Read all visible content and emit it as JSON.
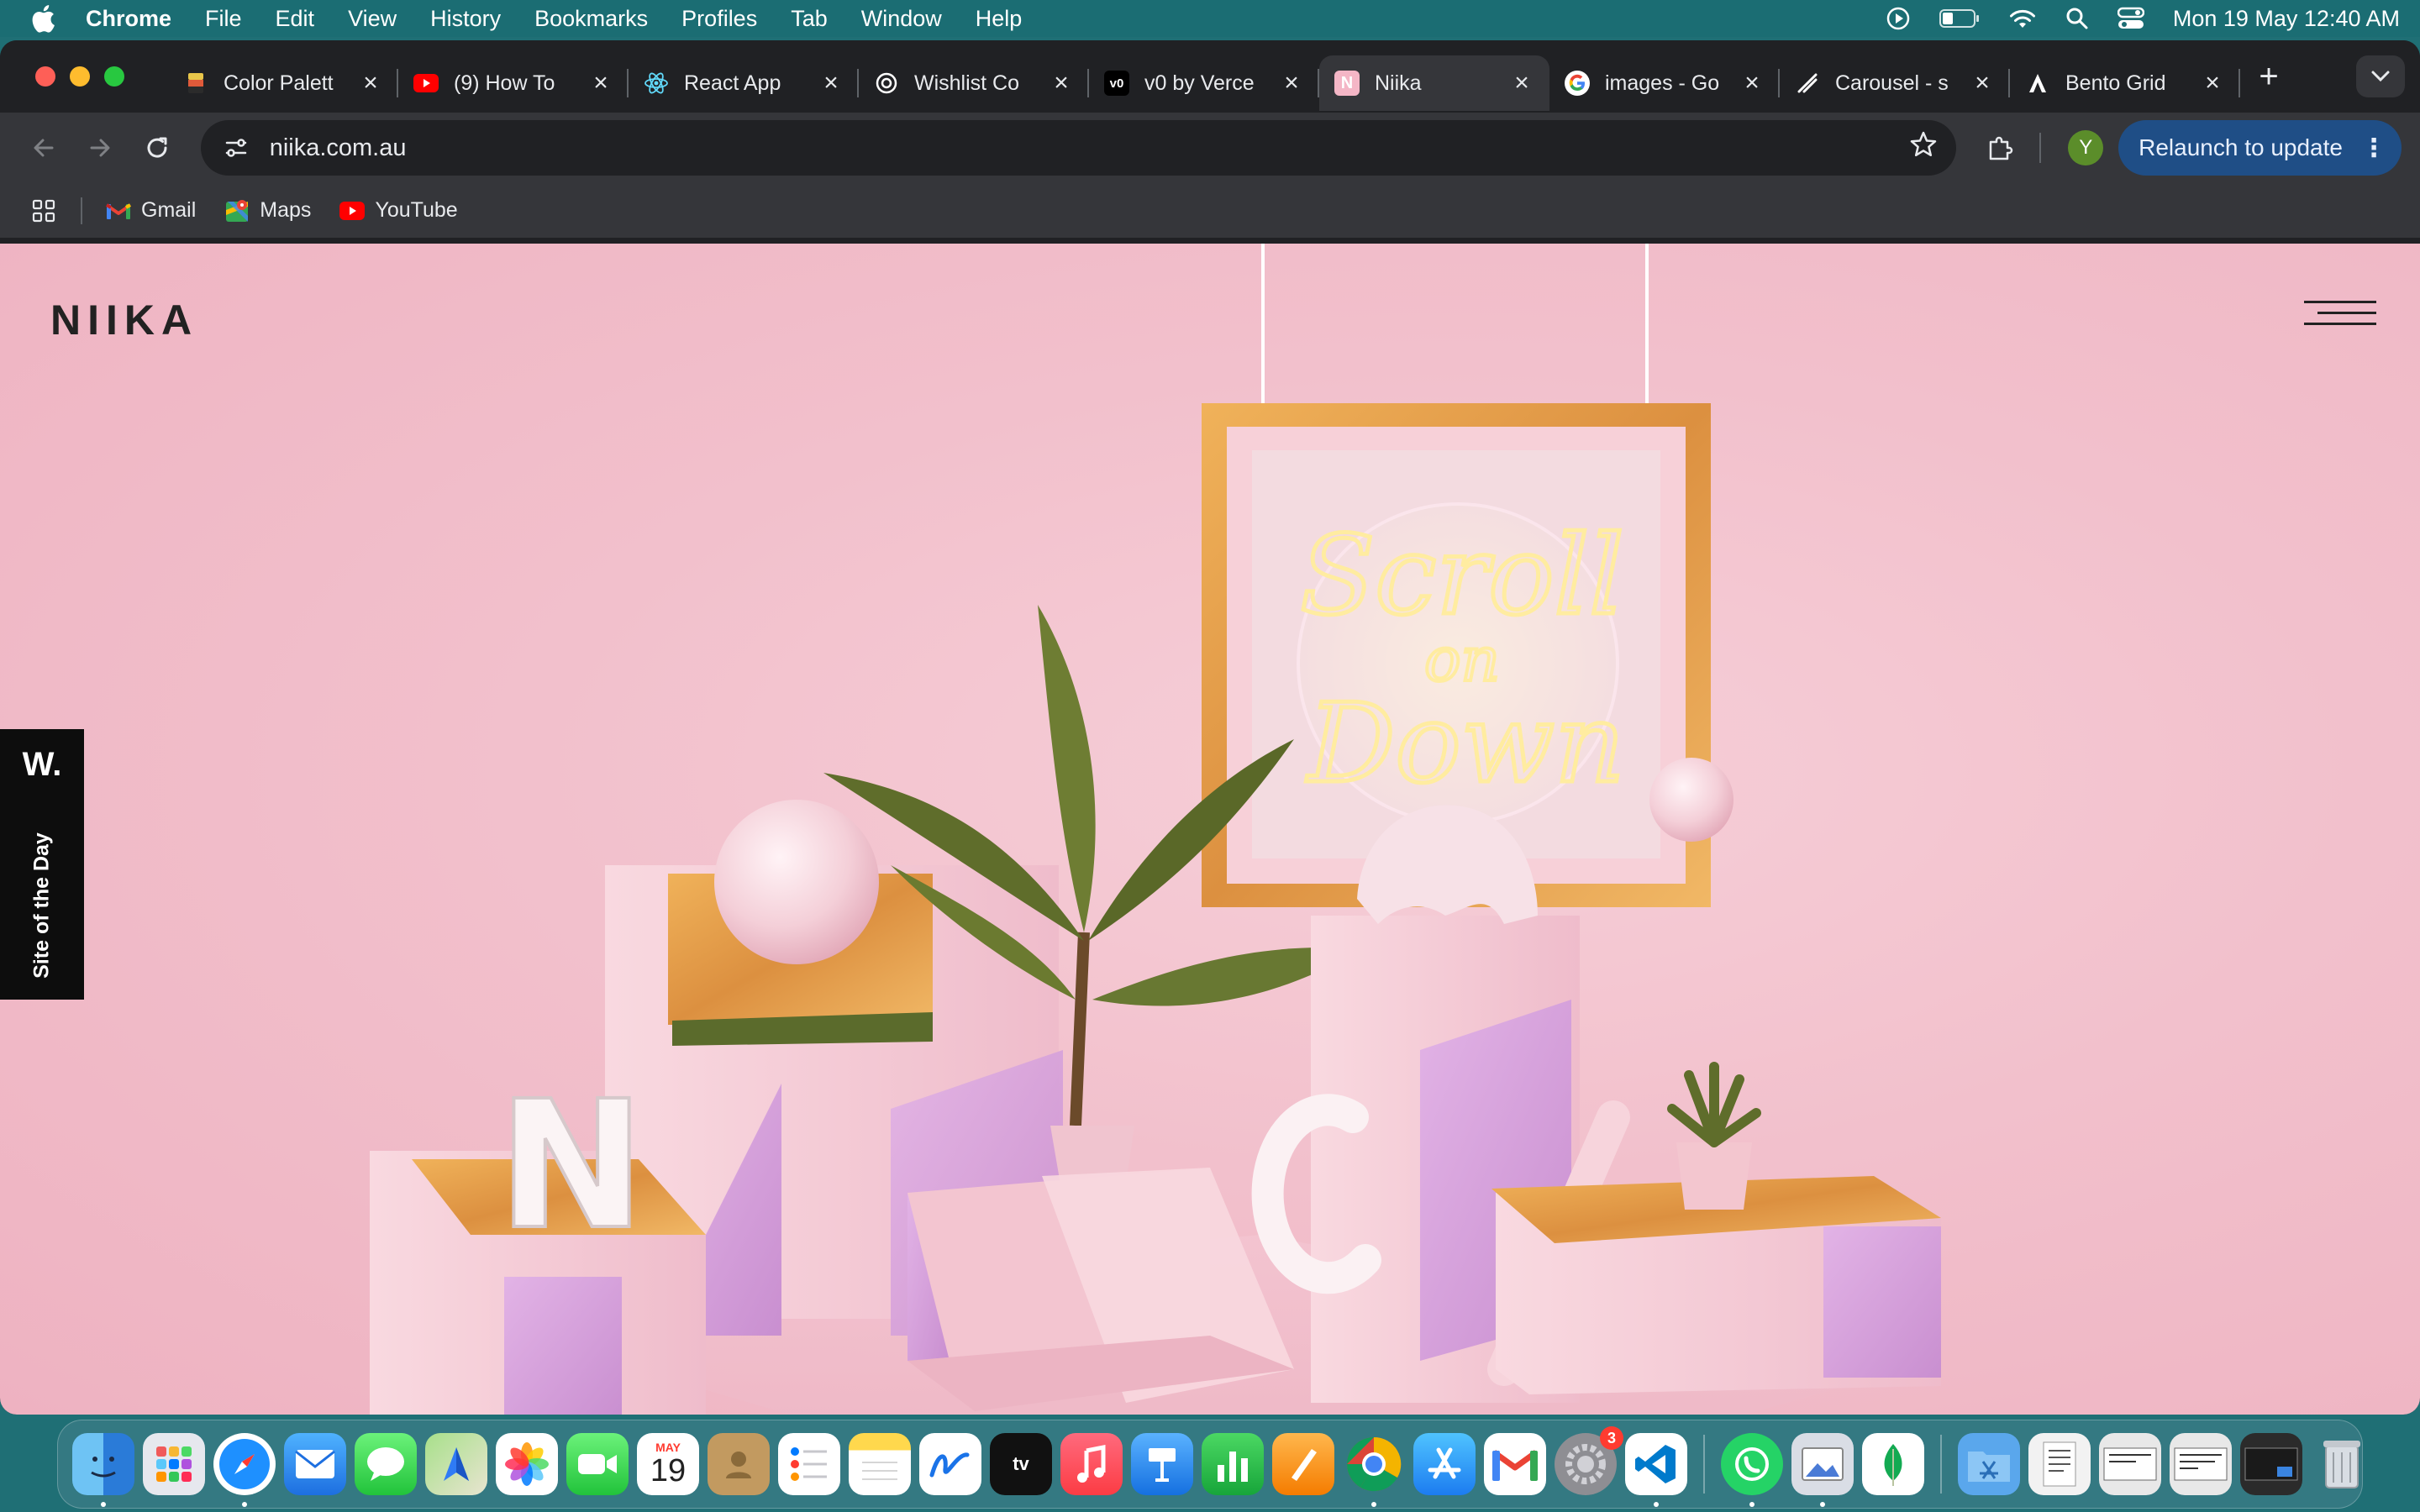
{
  "menubar": {
    "app_name": "Chrome",
    "items": [
      "File",
      "Edit",
      "View",
      "History",
      "Bookmarks",
      "Profiles",
      "Tab",
      "Window",
      "Help"
    ],
    "clock": "Mon 19 May  12:40 AM"
  },
  "tabs": [
    {
      "title": "Color Palett",
      "icon": "color-palette-favicon",
      "color": "#e8c64a",
      "active": false
    },
    {
      "title": "(9) How To",
      "icon": "youtube-favicon",
      "color": "#ff0000",
      "active": false
    },
    {
      "title": "React App",
      "icon": "react-favicon",
      "color": "#61dafb",
      "active": false
    },
    {
      "title": "Wishlist Co",
      "icon": "openai-favicon",
      "color": "#ffffff",
      "active": false
    },
    {
      "title": "v0 by Verce",
      "icon": "v0-favicon",
      "color": "#000000",
      "active": false
    },
    {
      "title": "Niika",
      "icon": "niika-favicon",
      "color": "#f4b6c6",
      "active": true
    },
    {
      "title": "images - Go",
      "icon": "google-favicon",
      "color": "#4285f4",
      "active": false
    },
    {
      "title": "Carousel - s",
      "icon": "carousel-favicon",
      "color": "#202124",
      "active": false
    },
    {
      "title": "Bento Grid",
      "icon": "bento-favicon",
      "color": "#000000",
      "active": false
    }
  ],
  "toolbar": {
    "url": "niika.com.au",
    "avatar_letter": "Y",
    "relaunch_label": "Relaunch to update"
  },
  "bookmarks": [
    {
      "label": "Gmail",
      "icon": "gmail-icon"
    },
    {
      "label": "Maps",
      "icon": "maps-icon"
    },
    {
      "label": "YouTube",
      "icon": "youtube-icon"
    }
  ],
  "page": {
    "logo": "NIIKA",
    "awards_mark": "W.",
    "awards_label": "Site of the Day",
    "neon_line1": "Scroll",
    "neon_line2": "on",
    "neon_line3": "Down",
    "letter_block": "N",
    "background_color": "#f2c0cc"
  },
  "dock": {
    "calendar_month": "MAY",
    "calendar_day": "19",
    "settings_badge": "3",
    "apps": [
      "finder",
      "launchpad",
      "safari",
      "mail",
      "messages",
      "maps",
      "photos",
      "facetime",
      "calendar",
      "contacts",
      "reminders",
      "notes",
      "freeform",
      "tv",
      "music",
      "keynote",
      "numbers",
      "pages",
      "chrome",
      "app-store",
      "gmail",
      "system-settings",
      "vscode",
      "whatsapp",
      "preview",
      "mongodb",
      "applications-folder",
      "document-stack",
      "screenshot-1",
      "screenshot-2",
      "screenshot-3",
      "trash"
    ]
  }
}
